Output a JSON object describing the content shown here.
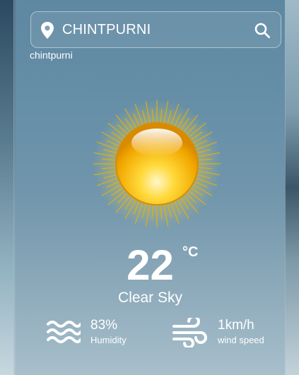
{
  "search": {
    "value": "CHINTPURNI",
    "location_icon": "map-pin-icon",
    "search_icon": "search-icon"
  },
  "city_label": "chintpurni",
  "weather": {
    "icon": "sun-icon",
    "temperature": "22",
    "unit": "°C",
    "description": "Clear Sky"
  },
  "stats": {
    "humidity": {
      "icon": "waves-icon",
      "value": "83%",
      "label": "Humidity"
    },
    "wind": {
      "icon": "wind-icon",
      "value": "1km/h",
      "label": "wind speed"
    }
  },
  "colors": {
    "text": "#ffffff",
    "sun_core": "#f2b705",
    "sun_rays": "#e7b500"
  }
}
